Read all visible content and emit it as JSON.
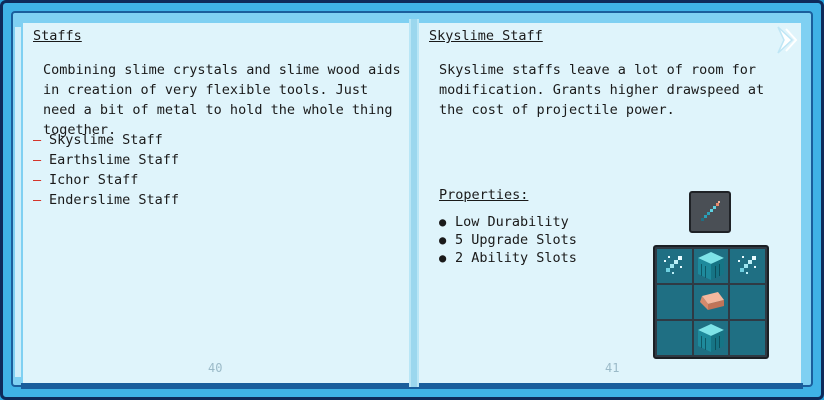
{
  "left_page": {
    "title": "Staffs",
    "description": "Combining slime crystals and slime wood aids in creation of very flexible tools. Just need a bit of metal to hold the whole thing together.",
    "items": [
      "Skyslime Staff",
      "Earthslime Staff",
      "Ichor Staff",
      "Enderslime Staff"
    ],
    "page_number": "40"
  },
  "right_page": {
    "title": "Skyslime Staff",
    "description": "Skyslime staffs leave a lot of room for modification. Grants higher drawspeed at the cost of projectile power.",
    "properties_label": "Properties:",
    "properties": [
      "Low Durability",
      "5 Upgrade Slots",
      "2 Ability Slots"
    ],
    "page_number": "41"
  },
  "recipe": {
    "result_icon": "skyslime-staff-icon",
    "grid": [
      [
        "slime-crystal-icon",
        "slime-log-icon",
        "slime-crystal-icon"
      ],
      [
        "",
        "copper-ingot-icon",
        ""
      ],
      [
        "",
        "slime-log-icon",
        ""
      ]
    ]
  },
  "colors": {
    "cover": "#3fb2e6",
    "page": "#dff4fb",
    "list_dash": "#d4261a",
    "grid_cell": "#1f6f83"
  }
}
